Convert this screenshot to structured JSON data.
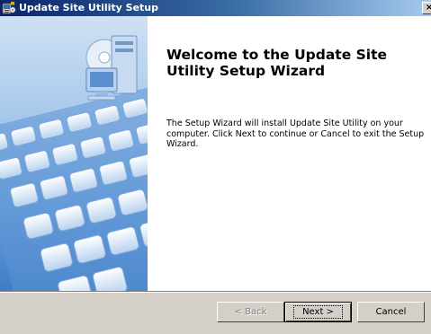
{
  "window": {
    "title": "Update Site Utility Setup",
    "close_glyph": "×"
  },
  "wizard": {
    "heading": "Welcome to the Update Site Utility Setup Wizard",
    "description": "The Setup Wizard will install Update Site Utility on your computer.  Click Next to continue or Cancel to exit the Setup Wizard."
  },
  "buttons": {
    "back": "< Back",
    "next": "Next >",
    "cancel": "Cancel"
  },
  "icons": {
    "title": "installer-icon",
    "banner": "computer-cd-icon",
    "keyboard": "keyboard-image"
  },
  "colors": {
    "titlebar_start": "#0a246a",
    "titlebar_end": "#a6caf0",
    "panel_blue": "#4f8bd0"
  }
}
